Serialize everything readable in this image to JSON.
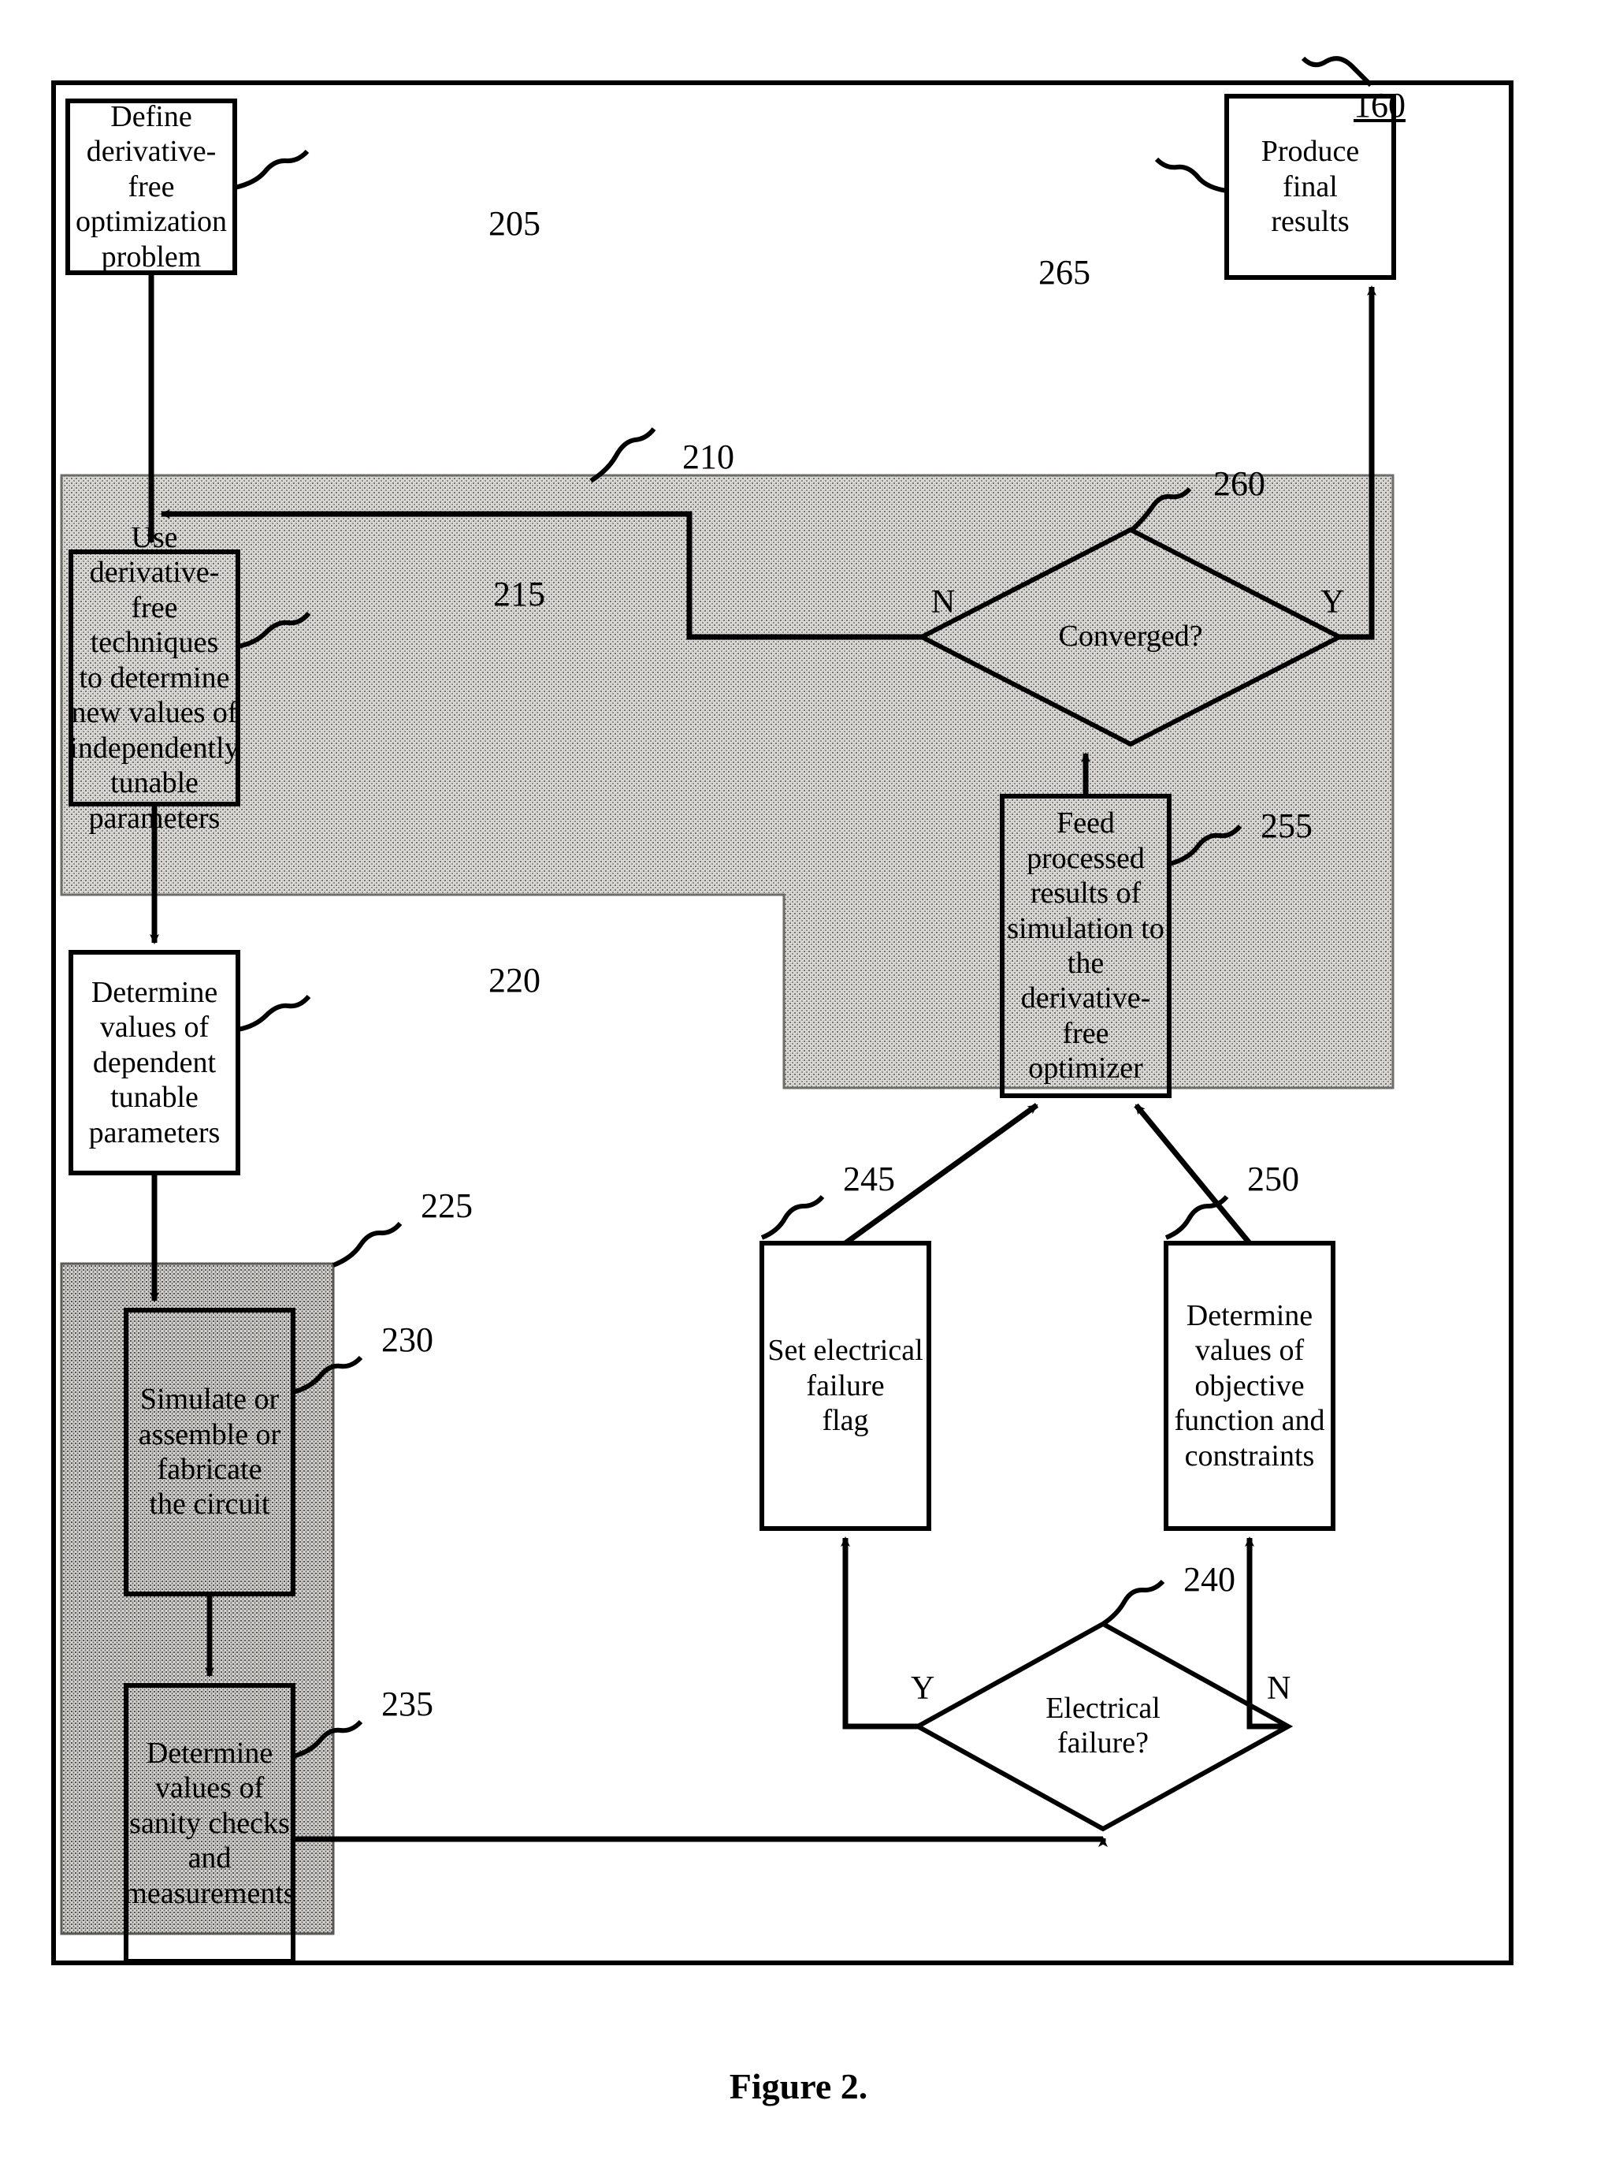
{
  "figure": {
    "caption": "Figure 2.",
    "outer_ref": "160"
  },
  "nodes": [
    {
      "id": "n205",
      "ref": "205",
      "kind": "process",
      "text": "Define\nderivative-free\noptimization\nproblem"
    },
    {
      "id": "n265",
      "ref": "265",
      "kind": "process",
      "text": "Produce\nfinal\nresults"
    },
    {
      "id": "n215",
      "ref": "215",
      "kind": "process",
      "text": "Use derivative-\nfree techniques\nto determine\nnew values of\nindependently\ntunable\nparameters"
    },
    {
      "id": "n260",
      "ref": "260",
      "kind": "decision",
      "text": "Converged?"
    },
    {
      "id": "n255",
      "ref": "255",
      "kind": "process",
      "text": "Feed processed\nresults of\nsimulation to\nthe\nderivative-free\noptimizer"
    },
    {
      "id": "n220",
      "ref": "220",
      "kind": "process",
      "text": "Determine\nvalues of\ndependent\ntunable\nparameters"
    },
    {
      "id": "n230",
      "ref": "230",
      "kind": "process",
      "text": "Simulate or\nassemble or\nfabricate\nthe circuit"
    },
    {
      "id": "n235",
      "ref": "235",
      "kind": "process",
      "text": "Determine\nvalues of\nsanity checks\nand\nmeasurements"
    },
    {
      "id": "n245",
      "ref": "245",
      "kind": "process",
      "text": "Set electrical\nfailure\nflag"
    },
    {
      "id": "n250",
      "ref": "250",
      "kind": "process",
      "text": "Determine\nvalues of\nobjective\nfunction and\nconstraints"
    },
    {
      "id": "n240",
      "ref": "240",
      "kind": "decision",
      "text": "Electrical\nfailure?"
    }
  ],
  "regions": [
    {
      "id": "r210",
      "ref": "210",
      "kind": "shaded-group"
    },
    {
      "id": "r225",
      "ref": "225",
      "kind": "shaded-group"
    }
  ],
  "branch_labels": {
    "converged_no": "N",
    "converged_yes": "Y",
    "elec_failure_yes": "Y",
    "elec_failure_no": "N"
  },
  "colors": {
    "line": "#000000",
    "shade_light": "#d4d2cf",
    "shade_mid": "#c9c6c2",
    "background": "#ffffff"
  }
}
